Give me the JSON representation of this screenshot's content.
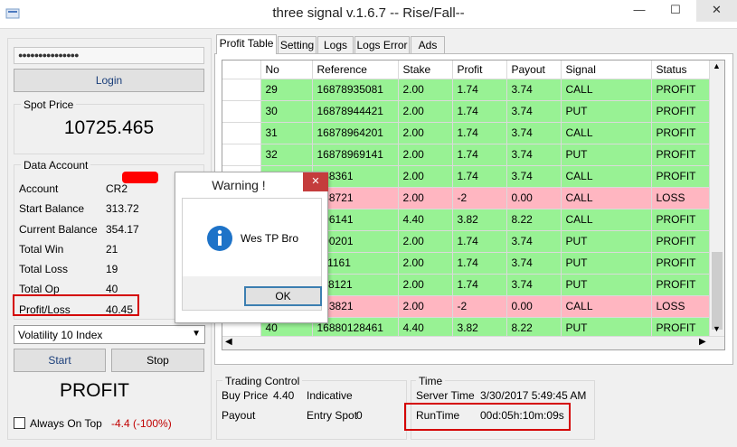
{
  "window": {
    "title": "three signal v.1.6.7 -- Rise/Fall--",
    "minimize": "—",
    "maximize": "☐",
    "close": "✕"
  },
  "login": {
    "password_mask": "●●●●●●●●●●●●●●●",
    "button": "Login"
  },
  "spot": {
    "label": "Spot Price",
    "value": "10725.465"
  },
  "account": {
    "group_label": "Data Account",
    "rows": [
      {
        "label": "Account",
        "value": "CR2"
      },
      {
        "label": "Start Balance",
        "value": "313.72"
      },
      {
        "label": "Current Balance",
        "value": "354.17"
      },
      {
        "label": "Total Win",
        "value": "21"
      },
      {
        "label": "Total Loss",
        "value": "19"
      },
      {
        "label": "Total Op",
        "value": "40"
      },
      {
        "label": "Profit/Loss",
        "value": "40.45"
      }
    ]
  },
  "market_select": "Volatility 10 Index",
  "start_button": "Start",
  "stop_button": "Stop",
  "result_text": "PROFIT",
  "always_on_top": "Always On Top",
  "pl_percent": "-4.4 (-100%)",
  "tabs": [
    "Profit Table",
    "Setting",
    "Logs",
    "Logs Error",
    "Ads"
  ],
  "table": {
    "columns": [
      "No",
      "Reference",
      "Stake",
      "Profit",
      "Payout",
      "Signal",
      "Status"
    ],
    "rows": [
      {
        "no": "29",
        "ref": "16878935081",
        "stake": "2.00",
        "profit": "1.74",
        "payout": "3.74",
        "signal": "CALL",
        "status": "PROFIT"
      },
      {
        "no": "30",
        "ref": "16878944421",
        "stake": "2.00",
        "profit": "1.74",
        "payout": "3.74",
        "signal": "PUT",
        "status": "PROFIT"
      },
      {
        "no": "31",
        "ref": "16878964201",
        "stake": "2.00",
        "profit": "1.74",
        "payout": "3.74",
        "signal": "CALL",
        "status": "PROFIT"
      },
      {
        "no": "32",
        "ref": "16878969141",
        "stake": "2.00",
        "profit": "1.74",
        "payout": "3.74",
        "signal": "PUT",
        "status": "PROFIT"
      },
      {
        "no": "",
        "ref": "988361",
        "stake": "2.00",
        "profit": "1.74",
        "payout": "3.74",
        "signal": "CALL",
        "status": "PROFIT"
      },
      {
        "no": "",
        "ref": "088721",
        "stake": "2.00",
        "profit": "-2",
        "payout": "0.00",
        "signal": "CALL",
        "status": "LOSS"
      },
      {
        "no": "",
        "ref": "096141",
        "stake": "4.40",
        "profit": "3.82",
        "payout": "8.22",
        "signal": "CALL",
        "status": "PROFIT"
      },
      {
        "no": "",
        "ref": "100201",
        "stake": "2.00",
        "profit": "1.74",
        "payout": "3.74",
        "signal": "PUT",
        "status": "PROFIT"
      },
      {
        "no": "",
        "ref": "111161",
        "stake": "2.00",
        "profit": "1.74",
        "payout": "3.74",
        "signal": "PUT",
        "status": "PROFIT"
      },
      {
        "no": "",
        "ref": "118121",
        "stake": "2.00",
        "profit": "1.74",
        "payout": "3.74",
        "signal": "PUT",
        "status": "PROFIT"
      },
      {
        "no": "",
        "ref": "123821",
        "stake": "2.00",
        "profit": "-2",
        "payout": "0.00",
        "signal": "CALL",
        "status": "LOSS"
      },
      {
        "no": "40",
        "ref": "16880128461",
        "stake": "4.40",
        "profit": "3.82",
        "payout": "8.22",
        "signal": "PUT",
        "status": "PROFIT"
      }
    ]
  },
  "trading_control": {
    "label": "Trading Control",
    "buy_price_label": "Buy Price",
    "buy_price": "4.40",
    "indicative_label": "Indicative",
    "payout_label": "Payout",
    "entry_spot_label": "Entry Spot",
    "entry_spot": "0"
  },
  "time": {
    "label": "Time",
    "server_time_label": "Server Time",
    "server_time": "3/30/2017 5:49:45 AM",
    "runtime_label": "RunTime",
    "runtime": "00d:05h:10m:09s"
  },
  "dialog": {
    "title": "Warning !",
    "message": "Wes TP Bro",
    "ok": "OK",
    "close": "✕"
  },
  "colors": {
    "profit_row": "#98f294",
    "loss_row": "#ffb6c1",
    "highlight": "#d40000",
    "info_icon": "#1e73c8"
  }
}
